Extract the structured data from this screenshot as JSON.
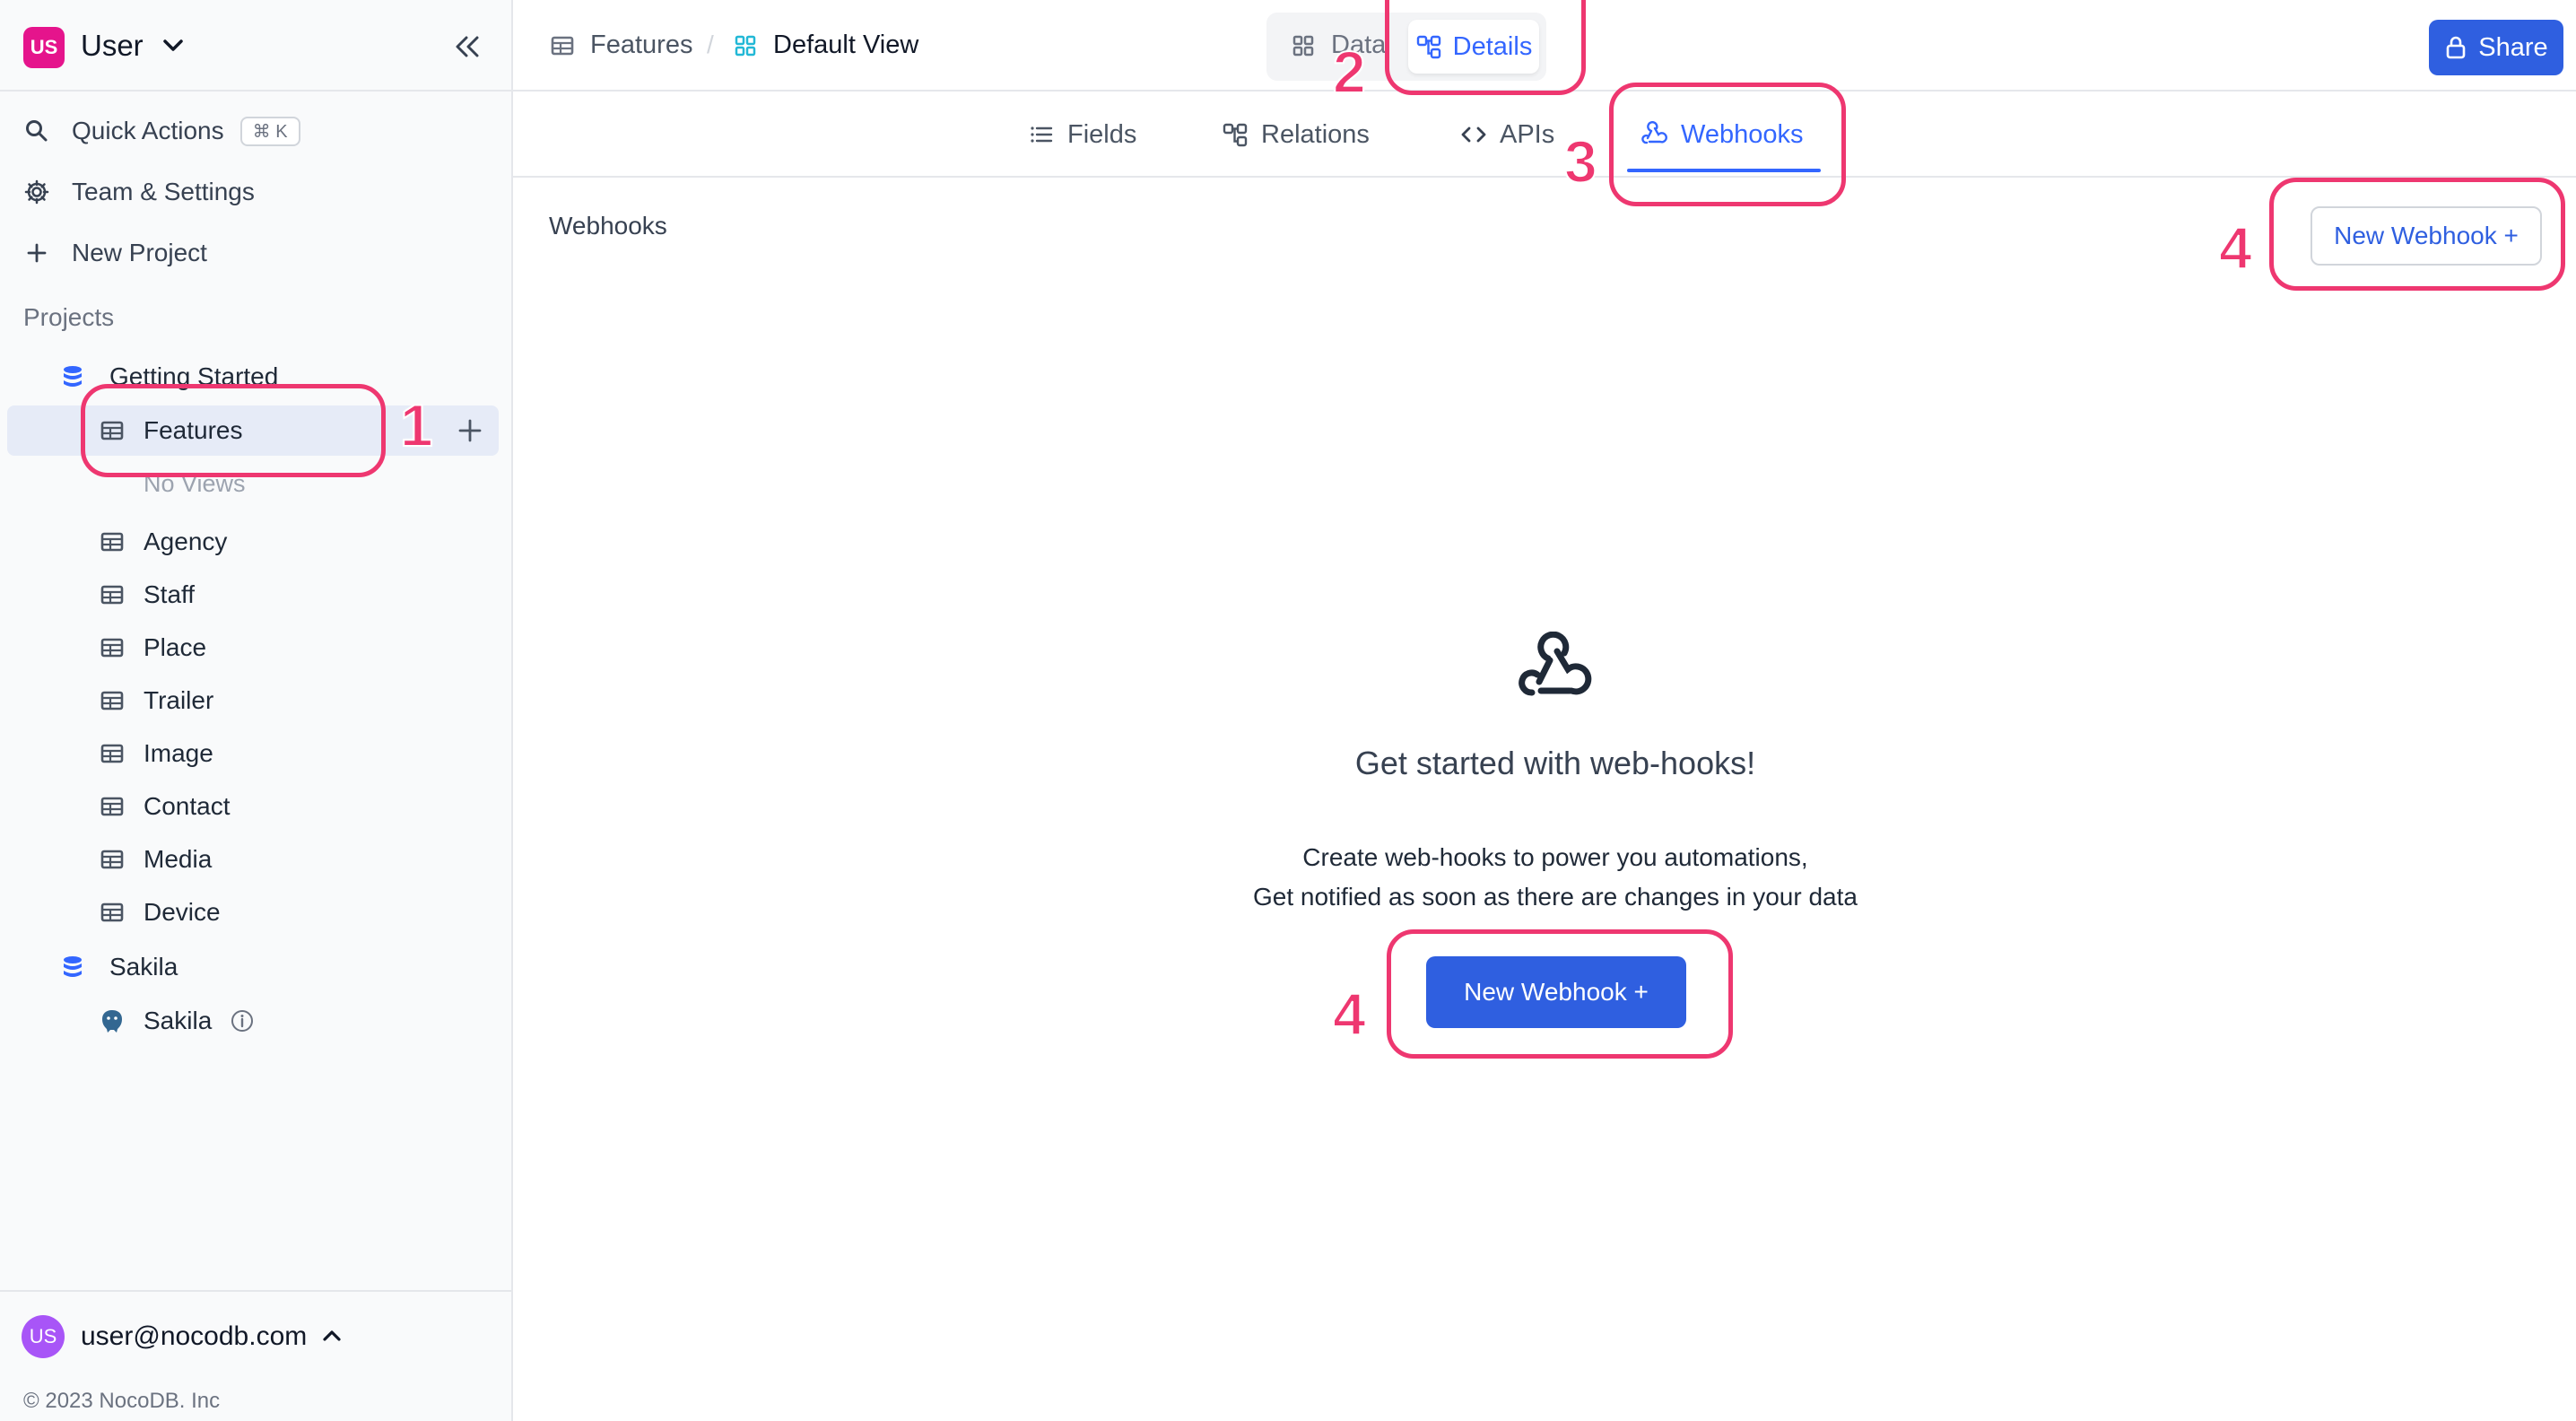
{
  "workspace": {
    "avatar_initials": "US",
    "name": "User"
  },
  "sidebar": {
    "menu": [
      {
        "label": "Quick Actions",
        "shortcut": "⌘ K",
        "icon": "search-icon"
      },
      {
        "label": "Team & Settings",
        "icon": "gear-icon"
      },
      {
        "label": "New Project",
        "icon": "plus-icon"
      }
    ],
    "projects_title": "Projects",
    "projects": [
      {
        "name": "Getting Started",
        "tables": [
          {
            "label": "Features",
            "no_views": "No Views"
          },
          {
            "label": "Agency"
          },
          {
            "label": "Staff"
          },
          {
            "label": "Place"
          },
          {
            "label": "Trailer"
          },
          {
            "label": "Image"
          },
          {
            "label": "Contact"
          },
          {
            "label": "Media"
          },
          {
            "label": "Device"
          }
        ]
      },
      {
        "name": "Sakila",
        "sources": [
          {
            "label": "Sakila",
            "icon": "postgres-icon"
          }
        ]
      }
    ]
  },
  "footer": {
    "avatar_initials": "US",
    "email": "user@nocodb.com",
    "copyright": "© 2023 NocoDB. Inc"
  },
  "topbar": {
    "breadcrumb": [
      {
        "label": "Features"
      },
      {
        "label": "Default View"
      }
    ],
    "separator": "/",
    "toggle": {
      "data_label": "Data",
      "details_label": "Details",
      "active": "Details"
    },
    "share_label": "Share"
  },
  "tabs": [
    {
      "label": "Fields",
      "icon": "list-icon"
    },
    {
      "label": "Relations",
      "icon": "relations-icon"
    },
    {
      "label": "APIs",
      "icon": "code-icon"
    },
    {
      "label": "Webhooks",
      "icon": "webhook-icon",
      "active": true
    }
  ],
  "content": {
    "section_label": "Webhooks",
    "new_webhook_label": "New Webhook +",
    "empty_title": "Get started with web-hooks!",
    "empty_line1": "Create web-hooks to power you automations,",
    "empty_line2": "Get notified as soon as there are changes in your data",
    "empty_button": "New Webhook +"
  },
  "annotations": [
    "1",
    "2",
    "3",
    "4",
    "4"
  ],
  "colors": {
    "accent": "#3366ff",
    "primary_button": "#2f5fe0",
    "annotation": "#ee3770",
    "workspace_avatar": "#e5148c"
  }
}
